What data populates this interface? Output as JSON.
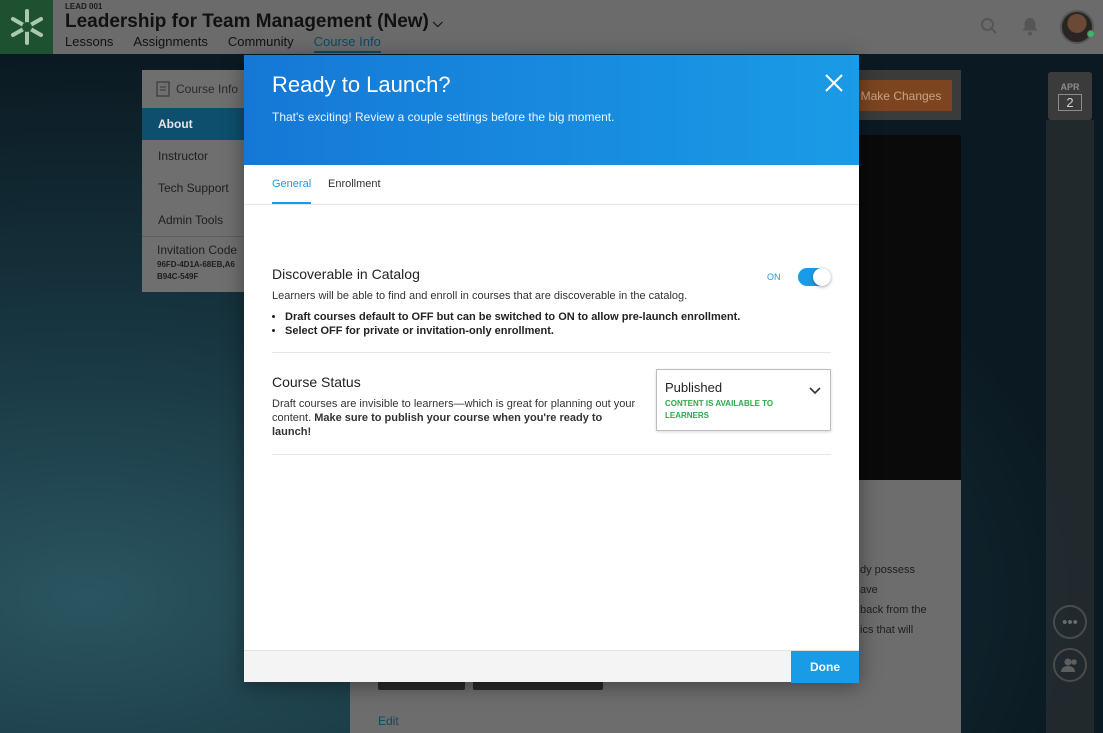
{
  "header": {
    "course_code": "LEAD 001",
    "course_title": "Leadership for Team Management (New)",
    "nav": [
      "Lessons",
      "Assignments",
      "Community",
      "Course Info"
    ],
    "active_nav": "Course Info"
  },
  "side_panel": {
    "header": "Course Info",
    "items": [
      "About",
      "Instructor",
      "Tech Support",
      "Admin Tools"
    ],
    "invitation_label": "Invitation Code",
    "invitation_code": "96FD-4D1A-68EB,A6\nB94C-549F"
  },
  "background": {
    "make_changes_label": "Make Changes",
    "date_month": "APR",
    "date_day": "2",
    "content_lines": [
      "dy possess",
      "ave",
      "back from the",
      "ics that will"
    ],
    "edit_label": "Edit"
  },
  "modal": {
    "title": "Ready to Launch?",
    "subtitle": "That's exciting! Review a couple settings before the big moment.",
    "tabs": [
      "General",
      "Enrollment"
    ],
    "active_tab": "General",
    "discoverable": {
      "title": "Discoverable in Catalog",
      "description": "Learners will be able to find and enroll in courses that are discoverable in the catalog.",
      "bullets": [
        "Draft courses default to OFF but can be switched to ON to allow pre-launch enrollment.",
        "Select OFF for private or invitation-only enrollment."
      ],
      "toggle_label": "ON",
      "toggle_on": true
    },
    "course_status": {
      "title": "Course Status",
      "description_plain": "Draft courses are invisible to learners—which is great for planning out your content.",
      "description_bold": "Make sure to publish your course when you're ready to launch!",
      "selected": "Published",
      "hint": "CONTENT IS AVAILABLE TO LEARNERS"
    },
    "done_label": "Done"
  },
  "colors": {
    "accent": "#1a9be6",
    "success": "#2ea84a",
    "header_gradient_start": "#1578d6"
  }
}
